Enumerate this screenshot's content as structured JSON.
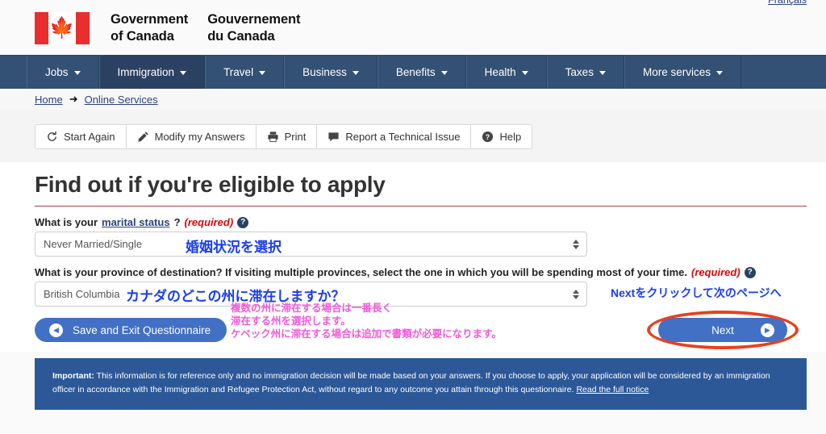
{
  "header": {
    "lang_link": "Français",
    "brand_en": "Government\nof Canada",
    "brand_en_l1": "Government",
    "brand_en_l2": "of Canada",
    "brand_fr_l1": "Gouvernement",
    "brand_fr_l2": "du Canada",
    "flag_leaf_icon": "maple-leaf-icon"
  },
  "nav": {
    "items": [
      {
        "label": "Jobs",
        "active": false
      },
      {
        "label": "Immigration",
        "active": true
      },
      {
        "label": "Travel",
        "active": false
      },
      {
        "label": "Business",
        "active": false
      },
      {
        "label": "Benefits",
        "active": false
      },
      {
        "label": "Health",
        "active": false
      },
      {
        "label": "Taxes",
        "active": false
      },
      {
        "label": "More services",
        "active": false
      }
    ]
  },
  "breadcrumb": {
    "home": "Home",
    "separator": "➜",
    "current": "Online Services"
  },
  "toolbar": {
    "start_again": "Start Again",
    "modify": "Modify my Answers",
    "print": "Print",
    "report": "Report a Technical Issue",
    "help": "Help"
  },
  "main": {
    "title": "Find out if you're eligible to apply",
    "question1": {
      "prefix": "What is your ",
      "link": "marital status",
      "suffix": "?",
      "required": "(required)",
      "help_icon": "?",
      "value": "Never Married/Single",
      "annotation": "婚姻状況を選択"
    },
    "question2": {
      "text": "What is your province of destination? If visiting multiple provinces, select the one in which you will be spending most of your time.",
      "required": "(required)",
      "help_icon": "?",
      "value": "British Columbia",
      "annotation": "カナダのどこの州に滞在しますか？",
      "note_line1": "複数の州に滞在する場合は一番長く",
      "note_line2": "滞在する州を選択します。",
      "note_line3": "ケベック州に滞在する場合は追加で書類が必要になります。"
    },
    "buttons": {
      "save_exit": "Save and Exit Questionnaire",
      "next": "Next",
      "next_annotation": "Nextをクリックして次のページへ"
    }
  },
  "important": {
    "label": "Important:",
    "body": " This information is for reference only and no immigration decision will be made based on your answers. If you choose to apply, your application will be considered by an immigration officer in accordance with the Immigration and Refugee Protection Act, without regard to any outcome you attain through this questionnaire. ",
    "link": "Read the full notice"
  },
  "colors": {
    "nav_blue": "#335075",
    "nav_active": "#2b4162",
    "accent_red": "#af3c43",
    "button_blue": "#4270c4",
    "banner_blue": "#2c5898",
    "annotation_blue": "#1a3df0",
    "annotation_magenta": "#ef5ad8",
    "highlight_red": "#e8401f",
    "required_red": "#d3080c",
    "link_blue": "#2b4380"
  }
}
